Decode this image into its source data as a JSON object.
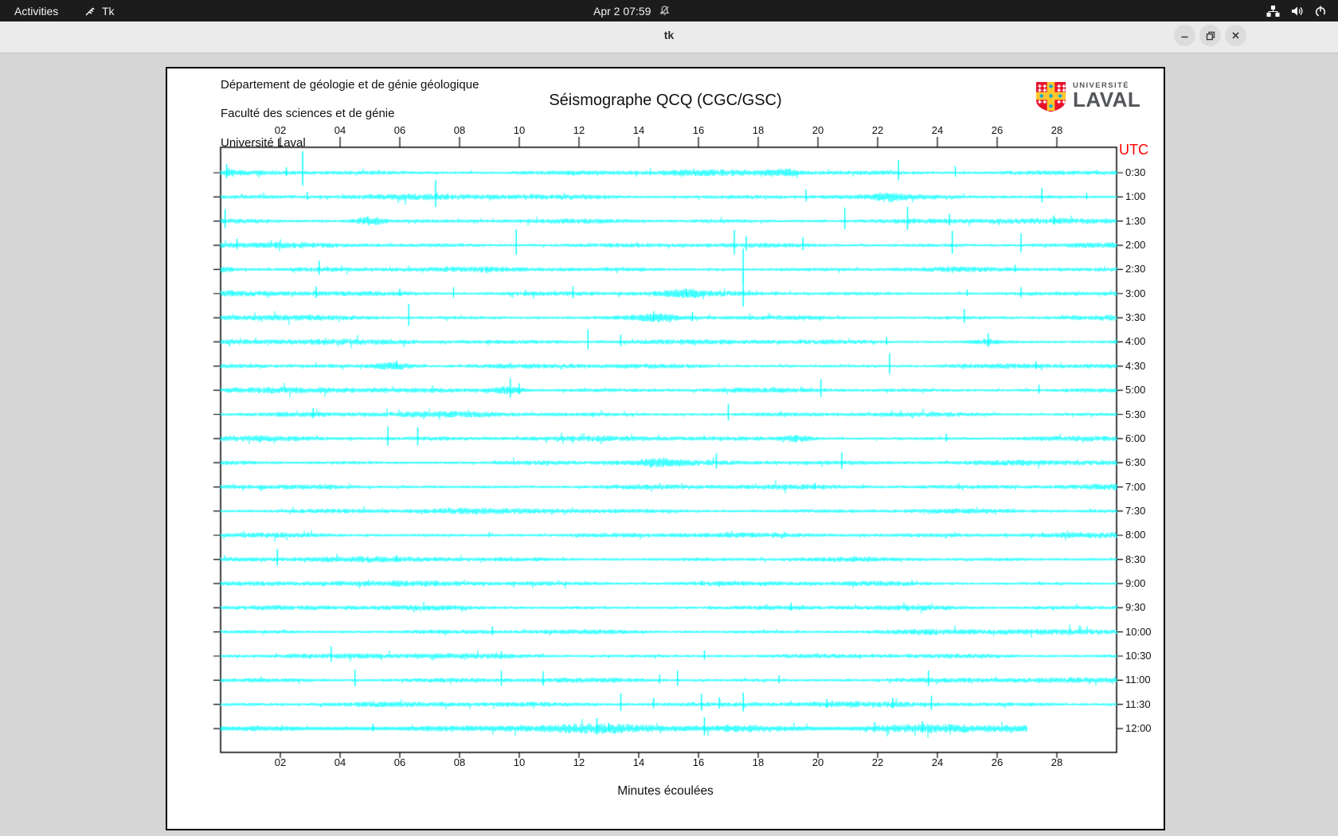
{
  "top_bar": {
    "activities_label": "Activities",
    "app_name": "Tk",
    "clock": "Apr 2 07:59"
  },
  "window": {
    "title": "tk"
  },
  "panel": {
    "org_lines": [
      "Département de géologie et de génie géologique",
      "Faculté des sciences et de génie",
      "Université Laval"
    ],
    "title": "Séismographe QCQ (CGC/GSC)",
    "utc_label": "UTC",
    "xlabel": "Minutes écoulées",
    "logo": {
      "univ": "UNIVERSITÉ",
      "name": "LAVAL"
    }
  },
  "colors": {
    "trace": "#00ffff",
    "utc": "#ff0000",
    "axis": "#000000",
    "logo_red": "#e8112d",
    "logo_gold": "#ffc72c",
    "logo_blue": "#00a9e0"
  },
  "chart_data": {
    "type": "line",
    "title": "Séismographe QCQ (CGC/GSC)",
    "xlabel": "Minutes écoulées",
    "right_axis_label": "UTC",
    "x_range_minutes": [
      0,
      30
    ],
    "x_ticks": [
      "02",
      "04",
      "06",
      "08",
      "10",
      "12",
      "14",
      "16",
      "18",
      "20",
      "22",
      "24",
      "26",
      "28"
    ],
    "x_tick_minutes": [
      2,
      4,
      6,
      8,
      10,
      12,
      14,
      16,
      18,
      20,
      22,
      24,
      26,
      28
    ],
    "grid": false,
    "seed": 1337,
    "rows": [
      {
        "label": "0:30",
        "spikes": [
          [
            0.2,
            11
          ],
          [
            2.2,
            7
          ],
          [
            2.75,
            27
          ],
          [
            22.7,
            16
          ],
          [
            24.6,
            8
          ]
        ],
        "bursts": [
          [
            18.8,
            4,
            0.9
          ],
          [
            0.3,
            3,
            0.4
          ]
        ]
      },
      {
        "label": "1:00",
        "spikes": [
          [
            2.9,
            6
          ],
          [
            7.2,
            21
          ],
          [
            19.6,
            9
          ],
          [
            27.5,
            11
          ],
          [
            29,
            5
          ]
        ],
        "bursts": [
          [
            22.4,
            4,
            0.8
          ]
        ]
      },
      {
        "label": "1:30",
        "spikes": [
          [
            0.15,
            15
          ],
          [
            20.9,
            17
          ],
          [
            23.0,
            18
          ],
          [
            24.4,
            9
          ],
          [
            27.9,
            7
          ]
        ],
        "bursts": [
          [
            5.0,
            5,
            0.8
          ]
        ]
      },
      {
        "label": "2:00",
        "spikes": [
          [
            0.55,
            8
          ],
          [
            9.9,
            20
          ],
          [
            17.2,
            19
          ],
          [
            17.6,
            11
          ],
          [
            19.5,
            10
          ],
          [
            24.5,
            18
          ],
          [
            26.8,
            15
          ]
        ],
        "bursts": []
      },
      {
        "label": "2:30",
        "spikes": [
          [
            3.3,
            11
          ],
          [
            17.5,
            26
          ],
          [
            26.6,
            6
          ]
        ],
        "bursts": [
          [
            0.2,
            3,
            0.5
          ]
        ]
      },
      {
        "label": "3:00",
        "spikes": [
          [
            3.2,
            9
          ],
          [
            6.0,
            6
          ],
          [
            7.8,
            8
          ],
          [
            11.8,
            9
          ],
          [
            15.6,
            6
          ],
          [
            17.5,
            27
          ],
          [
            25.0,
            5
          ],
          [
            26.8,
            8
          ]
        ],
        "bursts": [
          [
            15.5,
            4,
            1.0
          ]
        ]
      },
      {
        "label": "3:30",
        "spikes": [
          [
            6.3,
            17
          ],
          [
            14.5,
            8
          ],
          [
            15.8,
            7
          ],
          [
            24.9,
            11
          ]
        ],
        "bursts": [
          [
            14.5,
            4,
            1.2
          ]
        ]
      },
      {
        "label": "4:00",
        "spikes": [
          [
            12.3,
            16
          ],
          [
            13.4,
            9
          ],
          [
            22.3,
            6
          ],
          [
            25.7,
            11
          ]
        ],
        "bursts": [
          [
            25.6,
            3,
            0.8
          ]
        ]
      },
      {
        "label": "4:30",
        "spikes": [
          [
            5.9,
            7
          ],
          [
            22.4,
            16
          ],
          [
            27.3,
            6
          ]
        ],
        "bursts": [
          [
            5.8,
            4,
            1.0
          ]
        ]
      },
      {
        "label": "5:00",
        "spikes": [
          [
            9.7,
            15
          ],
          [
            10.0,
            9
          ],
          [
            20.1,
            14
          ],
          [
            27.4,
            7
          ]
        ],
        "bursts": [
          [
            9.6,
            4,
            0.9
          ]
        ]
      },
      {
        "label": "5:30",
        "spikes": [
          [
            3.1,
            8
          ],
          [
            17.0,
            13
          ]
        ],
        "bursts": []
      },
      {
        "label": "6:00",
        "spikes": [
          [
            5.6,
            15
          ],
          [
            6.6,
            14
          ],
          [
            24.3,
            6
          ]
        ],
        "bursts": [
          [
            19.3,
            4,
            0.8
          ]
        ]
      },
      {
        "label": "6:30",
        "spikes": [
          [
            16.6,
            12
          ],
          [
            20.8,
            13
          ]
        ],
        "bursts": [
          [
            14.7,
            4,
            1.0
          ]
        ]
      },
      {
        "label": "7:00",
        "spikes": [
          [
            19.9,
            5
          ]
        ],
        "bursts": []
      },
      {
        "label": "7:30",
        "spikes": [],
        "bursts": []
      },
      {
        "label": "8:00",
        "spikes": [
          [
            9.0,
            4
          ]
        ],
        "bursts": []
      },
      {
        "label": "8:30",
        "spikes": [
          [
            1.9,
            13
          ],
          [
            5.9,
            5
          ]
        ],
        "bursts": []
      },
      {
        "label": "9:00",
        "spikes": [
          [
            16.1,
            4
          ]
        ],
        "bursts": []
      },
      {
        "label": "9:30",
        "spikes": [
          [
            19.1,
            6
          ]
        ],
        "bursts": []
      },
      {
        "label": "10:00",
        "spikes": [
          [
            9.1,
            7
          ]
        ],
        "bursts": []
      },
      {
        "label": "10:30",
        "spikes": [
          [
            3.7,
            12
          ],
          [
            9.4,
            6
          ],
          [
            16.2,
            7
          ]
        ],
        "bursts": []
      },
      {
        "label": "11:00",
        "spikes": [
          [
            4.5,
            13
          ],
          [
            9.4,
            12
          ],
          [
            10.8,
            11
          ],
          [
            14.7,
            7
          ],
          [
            15.3,
            12
          ],
          [
            18.7,
            6
          ],
          [
            23.7,
            12
          ]
        ],
        "bursts": []
      },
      {
        "label": "11:30",
        "spikes": [
          [
            13.4,
            14
          ],
          [
            14.5,
            8
          ],
          [
            16.1,
            13
          ],
          [
            16.7,
            9
          ],
          [
            17.5,
            15
          ],
          [
            20.3,
            7
          ],
          [
            22.5,
            8
          ],
          [
            23.8,
            11
          ]
        ],
        "bursts": []
      },
      {
        "label": "12:00",
        "spikes": [
          [
            5.1,
            6
          ],
          [
            12.6,
            13
          ],
          [
            13.0,
            7
          ],
          [
            16.2,
            14
          ],
          [
            21.9,
            8
          ],
          [
            23.5,
            9
          ]
        ],
        "bursts": [],
        "end_min": 27.0,
        "thick": true
      }
    ]
  }
}
